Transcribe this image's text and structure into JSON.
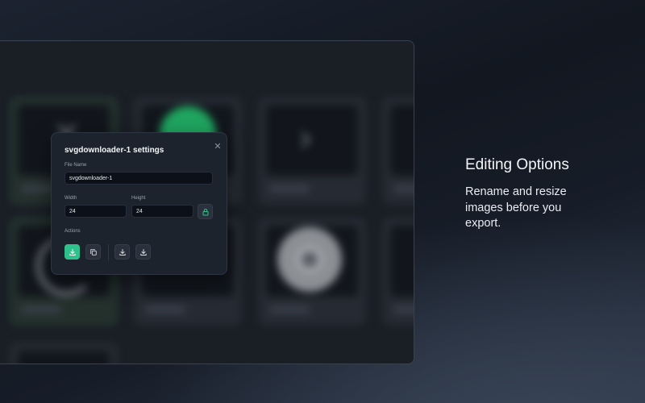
{
  "dialog": {
    "title": "svgdownloader-1 settings",
    "file_name_label": "File Name",
    "file_name_value": "svgdownloader-1",
    "width_label": "Width",
    "width_value": "24",
    "height_label": "Height",
    "height_value": "24",
    "actions_label": "Actions"
  },
  "sidebar": {
    "heading": "Editing Options",
    "description": "Rename and resize images before you export."
  },
  "icons": {
    "close": "close-icon",
    "lock": "lock-icon",
    "download": "download-icon",
    "copy": "copy-icon"
  },
  "colors": {
    "accent": "#2fc18c",
    "dialog_bg": "#1d232d",
    "field_bg": "#0c1018"
  }
}
